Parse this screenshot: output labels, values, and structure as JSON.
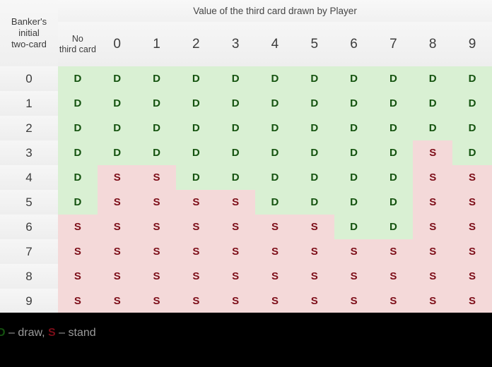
{
  "table": {
    "stub_title_lines": [
      "Banker's",
      "initial",
      "two-card"
    ],
    "group_header": "Value of the third card drawn by Player",
    "no_third_card_lines": [
      "No",
      "third card"
    ],
    "player_card_columns": [
      "0",
      "1",
      "2",
      "3",
      "4",
      "5",
      "6",
      "7",
      "8",
      "9"
    ],
    "row_labels": [
      "0",
      "1",
      "2",
      "3",
      "4",
      "5",
      "6",
      "7",
      "8",
      "9"
    ],
    "draw_symbol": "D",
    "stand_symbol": "S",
    "rows": [
      {
        "label": "0",
        "no_third_card": "D",
        "values": [
          "D",
          "D",
          "D",
          "D",
          "D",
          "D",
          "D",
          "D",
          "D",
          "D"
        ]
      },
      {
        "label": "1",
        "no_third_card": "D",
        "values": [
          "D",
          "D",
          "D",
          "D",
          "D",
          "D",
          "D",
          "D",
          "D",
          "D"
        ]
      },
      {
        "label": "2",
        "no_third_card": "D",
        "values": [
          "D",
          "D",
          "D",
          "D",
          "D",
          "D",
          "D",
          "D",
          "D",
          "D"
        ]
      },
      {
        "label": "3",
        "no_third_card": "D",
        "values": [
          "D",
          "D",
          "D",
          "D",
          "D",
          "D",
          "D",
          "D",
          "S",
          "D"
        ]
      },
      {
        "label": "4",
        "no_third_card": "D",
        "values": [
          "S",
          "S",
          "D",
          "D",
          "D",
          "D",
          "D",
          "D",
          "S",
          "S"
        ]
      },
      {
        "label": "5",
        "no_third_card": "D",
        "values": [
          "S",
          "S",
          "S",
          "S",
          "D",
          "D",
          "D",
          "D",
          "S",
          "S"
        ]
      },
      {
        "label": "6",
        "no_third_card": "S",
        "values": [
          "S",
          "S",
          "S",
          "S",
          "S",
          "S",
          "D",
          "D",
          "S",
          "S"
        ]
      },
      {
        "label": "7",
        "no_third_card": "S",
        "values": [
          "S",
          "S",
          "S",
          "S",
          "S",
          "S",
          "S",
          "S",
          "S",
          "S"
        ]
      },
      {
        "label": "8",
        "no_third_card": "S",
        "values": [
          "S",
          "S",
          "S",
          "S",
          "S",
          "S",
          "S",
          "S",
          "S",
          "S"
        ]
      },
      {
        "label": "9",
        "no_third_card": "S",
        "values": [
          "S",
          "S",
          "S",
          "S",
          "S",
          "S",
          "S",
          "S",
          "S",
          "S"
        ]
      }
    ]
  },
  "legend": {
    "draw_key": "D",
    "draw_text": " – draw, ",
    "stand_key": "S",
    "stand_text": " – stand"
  },
  "colors": {
    "draw_bg": "#d9f0d3",
    "draw_fg": "#14520f",
    "stand_bg": "#f4d9d9",
    "stand_fg": "#7c0d18",
    "header_bg": "#f2f2f2",
    "footer_bg": "#000000",
    "footer_fg": "#9a9a9a"
  }
}
